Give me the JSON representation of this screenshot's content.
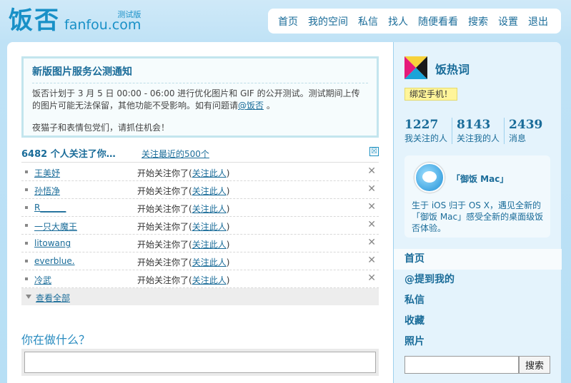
{
  "header": {
    "logo_cn": "饭否",
    "logo_en": "fanfou.com",
    "logo_beta": "测试版",
    "nav": [
      "首页",
      "我的空间",
      "私信",
      "找人",
      "随便看看",
      "搜索",
      "设置",
      "退出"
    ]
  },
  "notice": {
    "title": "新版图片服务公测通知",
    "body_before": "饭否计划于 3 月 5 日 00:00 - 06:00 进行优化图片和 GIF 的公开测试。测试期间上传的图片可能无法保留，其他功能不受影响。如有问题请",
    "mention": "@饭否",
    "body_after": " 。",
    "extra": "夜猫子和表情包党们，请抓住机会！"
  },
  "followers": {
    "count_label": "6482 个人关注了你…",
    "recent_link": "关注最近的500个",
    "close_icon": "☒",
    "message": "开始关注你了(",
    "follow_back": "关注此人",
    "message_end": ")",
    "delete_icon": "✕",
    "rows": [
      {
        "name": "王美妤"
      },
      {
        "name": "孙悟净"
      },
      {
        "name": "R______"
      },
      {
        "name": "一只大魔王"
      },
      {
        "name": "litowang"
      },
      {
        "name": "everblue."
      },
      {
        "name": "冷武"
      }
    ],
    "view_all": "查看全部"
  },
  "composer": {
    "label": "你在做什么？",
    "placeholder": ""
  },
  "sidebar": {
    "hot_title": "饭热词",
    "bind_phone": "绑定手机！",
    "stats": [
      {
        "num": "1227",
        "label": "我关注的人"
      },
      {
        "num": "8143",
        "label": "关注我的人"
      },
      {
        "num": "2439",
        "label": "消息"
      }
    ],
    "promo": {
      "title": "「御饭 Mac」",
      "text": "生于 iOS 归于 OS X，遇见全新的「御饭 Mac」感受全新的桌面级饭否体验。"
    },
    "menu": [
      "首页",
      "@提到我的",
      "私信",
      "收藏",
      "照片"
    ],
    "search_button": "搜索"
  }
}
